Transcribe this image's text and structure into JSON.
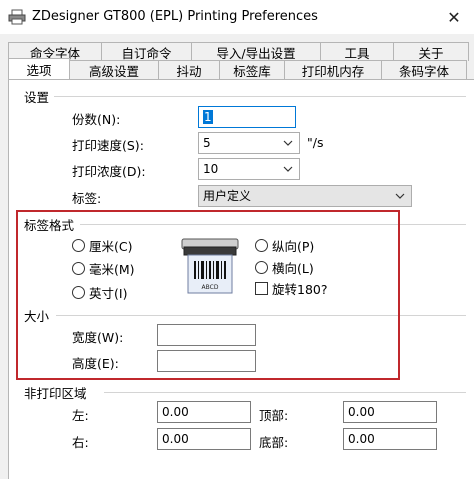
{
  "window": {
    "title": "ZDesigner GT800 (EPL) Printing Preferences",
    "close_glyph": "✕"
  },
  "tabs": {
    "row1": [
      "命令字体",
      "自订命令",
      "导入/导出设置",
      "工具",
      "关于"
    ],
    "row2": [
      "选项",
      "高级设置",
      "抖动",
      "标签库",
      "打印机内存",
      "条码字体"
    ],
    "active": "选项"
  },
  "settings": {
    "group_label": "设置",
    "copies_label": "份数(N):",
    "copies_value": "1",
    "speed_label": "打印速度(S):",
    "speed_value": "5",
    "speed_unit": "\"/s",
    "darkness_label": "打印浓度(D):",
    "darkness_value": "10",
    "label_label": "标签:",
    "label_value": "用户定义"
  },
  "label_format": {
    "group_label": "标签格式",
    "units": [
      "厘米(C)",
      "毫米(M)",
      "英寸(I)"
    ],
    "orientation": [
      "纵向(P)",
      "横向(L)"
    ],
    "rotate_label": "旋转180?",
    "preview_text": "ABCD"
  },
  "size": {
    "group_label": "大小",
    "width_label": "宽度(W):",
    "width_value": "",
    "height_label": "高度(E):",
    "height_value": ""
  },
  "non_print": {
    "group_label": "非打印区域",
    "left_label": "左:",
    "left_value": "0.00",
    "top_label": "顶部:",
    "top_value": "0.00",
    "right_label": "右:",
    "right_value": "0.00",
    "bottom_label": "底部:",
    "bottom_value": "0.00"
  },
  "colors": {
    "highlight": "#c0282c",
    "focus": "#0078d7"
  }
}
